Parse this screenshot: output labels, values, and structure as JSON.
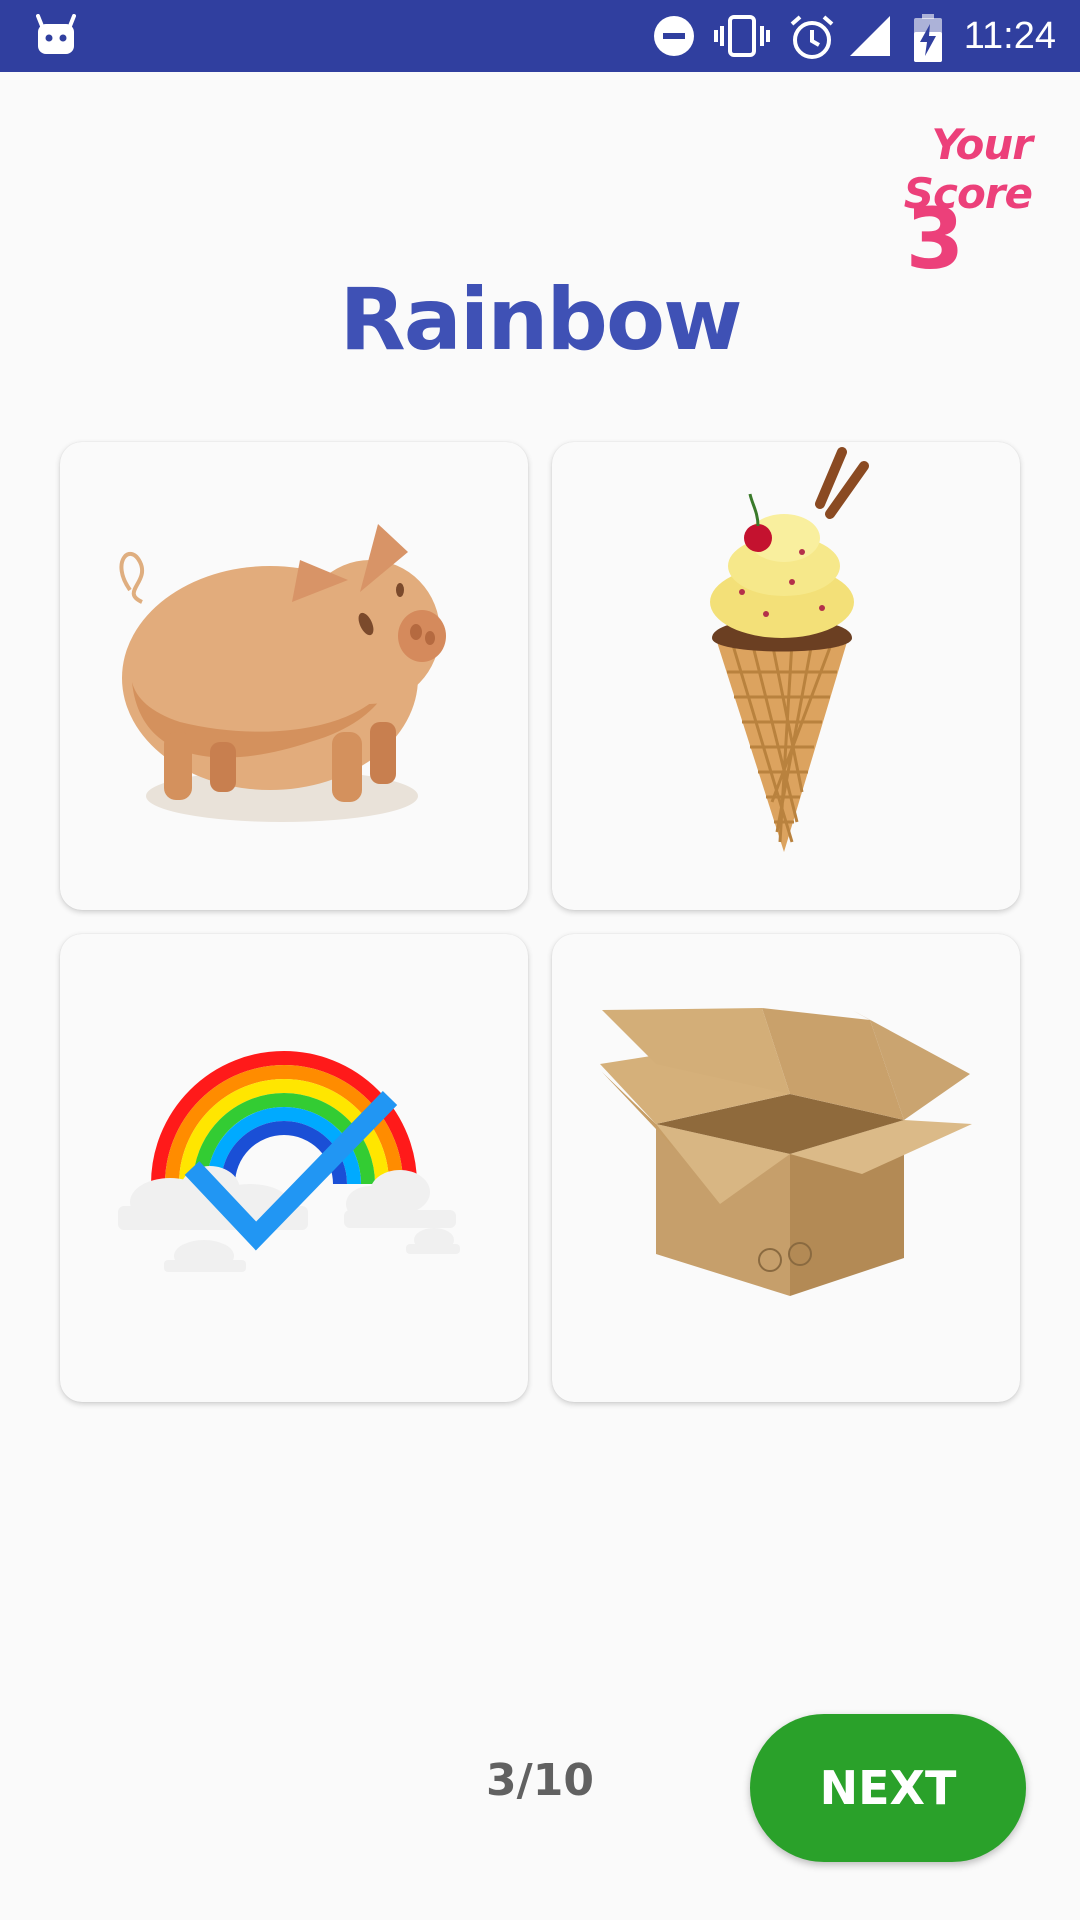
{
  "status_bar": {
    "time": "11:24",
    "icons": [
      "android-icon",
      "do-not-disturb-icon",
      "vibrate-icon",
      "alarm-icon",
      "signal-icon",
      "battery-charging-icon"
    ]
  },
  "score": {
    "label": "Your Score",
    "value": "3"
  },
  "question": {
    "word": "Rainbow"
  },
  "cards": [
    {
      "image": "pig-image",
      "selected": false
    },
    {
      "image": "ice-cream-cone-image",
      "selected": false
    },
    {
      "image": "rainbow-image",
      "selected": true,
      "mark": "checkmark-icon"
    },
    {
      "image": "cardboard-box-image",
      "selected": false
    }
  ],
  "footer": {
    "progress": "3/10",
    "next_label": "NEXT"
  },
  "colors": {
    "status_bar": "#303f9f",
    "score": "#ec407a",
    "question": "#3f51b5",
    "next_button": "#2aa12a",
    "checkmark": "#2196f3"
  }
}
